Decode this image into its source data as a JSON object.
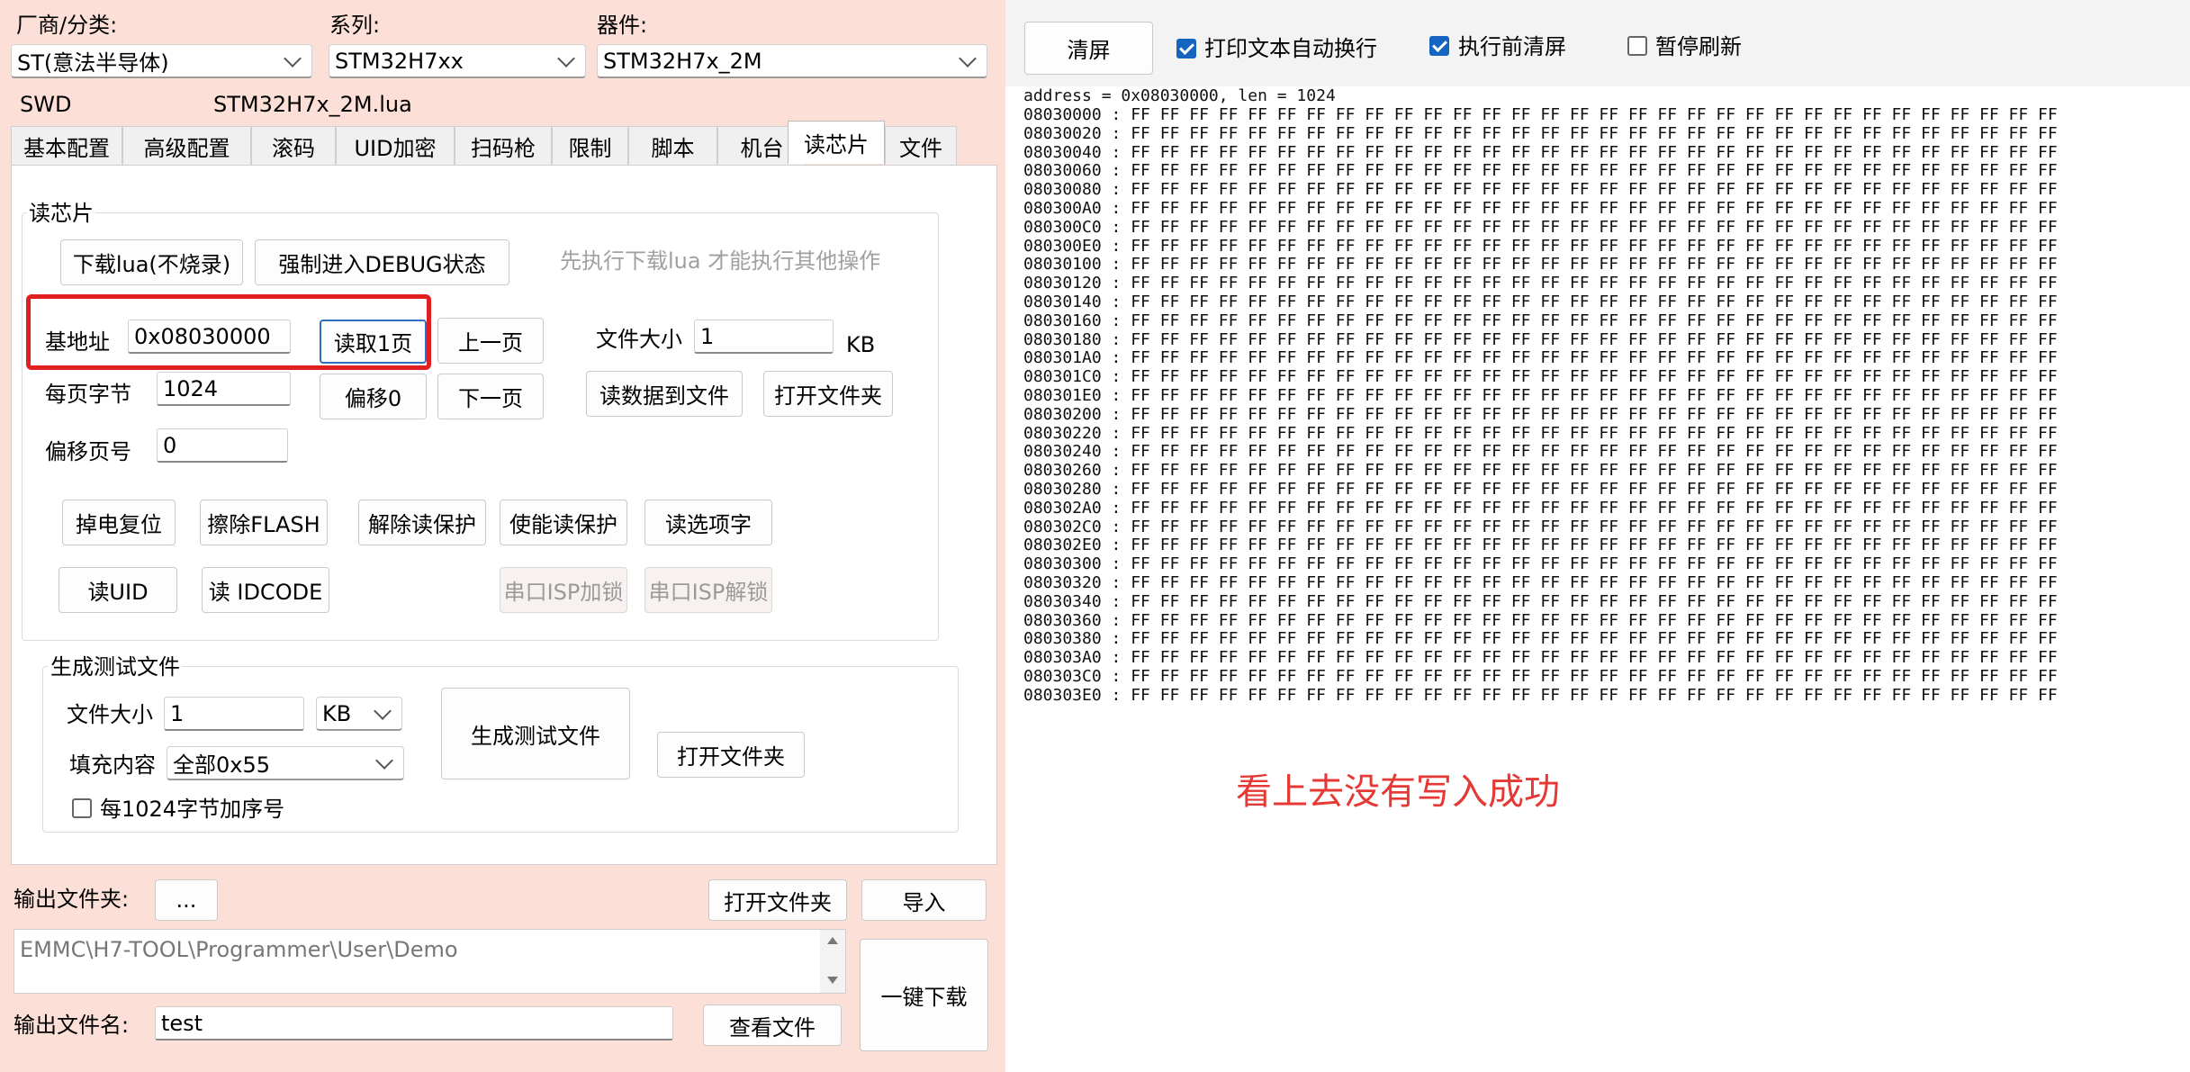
{
  "top": {
    "vendor_label": "厂商/分类:",
    "vendor_value": "ST(意法半导体)",
    "series_label": "系列:",
    "series_value": "STM32H7xx",
    "device_label": "器件:",
    "device_value": "STM32H7x_2M",
    "interface": "SWD",
    "lua_file": "STM32H7x_2M.lua"
  },
  "tabs": [
    "基本配置",
    "高级配置",
    "滚码",
    "UID加密",
    "扫码枪",
    "限制",
    "脚本",
    "机台",
    "读芯片",
    "文件"
  ],
  "read_chip": {
    "group_title": "读芯片",
    "download_lua": "下载lua(不烧录)",
    "force_debug": "强制进入DEBUG状态",
    "hint": "先执行下载lua 才能执行其他操作",
    "base_addr_label": "基地址",
    "base_addr_value": "0x08030000",
    "read_page": "读取1页",
    "prev_page": "上一页",
    "file_size_label": "文件大小",
    "file_size_value": "1",
    "file_size_unit": "KB",
    "bytes_per_page_label": "每页字节",
    "bytes_per_page_value": "1024",
    "offset0": "偏移0",
    "next_page": "下一页",
    "read_to_file": "读数据到文件",
    "open_folder": "打开文件夹",
    "offset_page_label": "偏移页号",
    "offset_page_value": "0",
    "power_reset": "掉电复位",
    "erase_flash": "擦除FLASH",
    "remove_protect": "解除读保护",
    "enable_protect": "使能读保护",
    "read_option": "读选项字",
    "read_uid": "读UID",
    "read_idcode": "读 IDCODE",
    "isp_lock": "串口ISP加锁",
    "isp_unlock": "串口ISP解锁"
  },
  "gen_test": {
    "group_title": "生成测试文件",
    "file_size_label": "文件大小",
    "file_size_value": "1",
    "unit_value": "KB",
    "fill_label": "填充内容",
    "fill_value": "全部0x55",
    "seq_label": "每1024字节加序号",
    "generate": "生成测试文件",
    "open_folder": "打开文件夹"
  },
  "output": {
    "folder_label": "输出文件夹:",
    "browse": "...",
    "open_folder": "打开文件夹",
    "import": "导入",
    "path": "EMMC\\H7-TOOL\\Programmer\\User\\Demo",
    "one_click": "一键下载",
    "filename_label": "输出文件名:",
    "filename_value": "test",
    "view_file": "查看文件"
  },
  "console": {
    "clear": "清屏",
    "auto_wrap": "打印文本自动换行",
    "auto_wrap_checked": true,
    "clear_before": "执行前清屏",
    "clear_before_checked": true,
    "pause": "暂停刷新",
    "pause_checked": false,
    "header": "address = 0x08030000, len = 1024",
    "addresses": [
      "08030000",
      "08030020",
      "08030040",
      "08030060",
      "08030080",
      "080300A0",
      "080300C0",
      "080300E0",
      "08030100",
      "08030120",
      "08030140",
      "08030160",
      "08030180",
      "080301A0",
      "080301C0",
      "080301E0",
      "08030200",
      "08030220",
      "08030240",
      "08030260",
      "08030280",
      "080302A0",
      "080302C0",
      "080302E0",
      "08030300",
      "08030320",
      "08030340",
      "08030360",
      "08030380",
      "080303A0",
      "080303C0",
      "080303E0"
    ],
    "byte": "FF",
    "bytes_per_row": 32,
    "annotation": "看上去没有写入成功",
    "annotation_color": "#e53935"
  },
  "colors": {
    "highlight": "#e02020",
    "check_blue": "#1565c0"
  }
}
